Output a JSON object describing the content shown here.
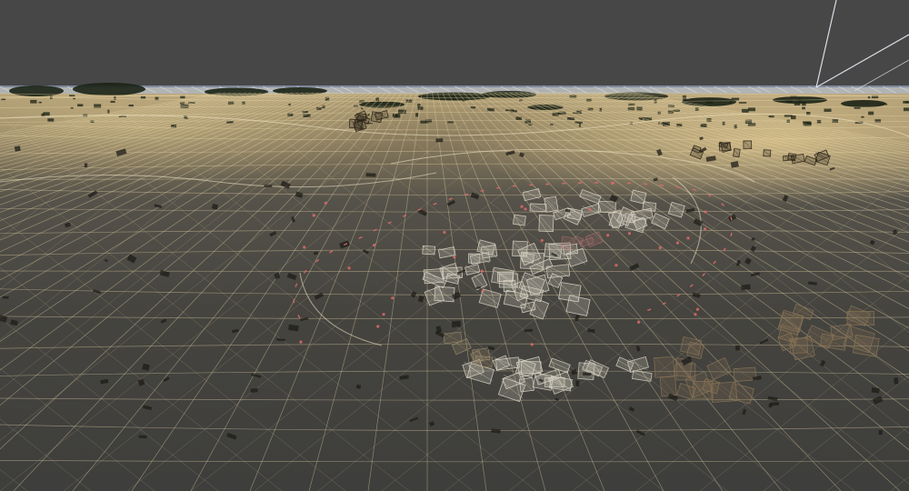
{
  "viewport": {
    "mode": "wireframe-shaded",
    "colors": {
      "sky": "#474747",
      "terrain_base": "#3f3f3c",
      "terrain_far_lit": "#cdb98a",
      "grid_line": "#e9d8a8",
      "distant_water": "#a9bde0",
      "foliage": "#1b2215",
      "wire_objects": "#d8d2c4",
      "selected_spline": "#e06a6a"
    }
  }
}
